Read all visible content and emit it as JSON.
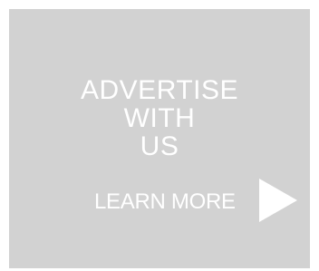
{
  "ad": {
    "headline_lines": [
      "ADVERTISE",
      "WITH",
      "US"
    ],
    "cta_label": "LEARN MORE",
    "arrow_icon": "play-arrow-icon",
    "background_color": "#d2d2d2",
    "text_color": "#ffffff"
  }
}
